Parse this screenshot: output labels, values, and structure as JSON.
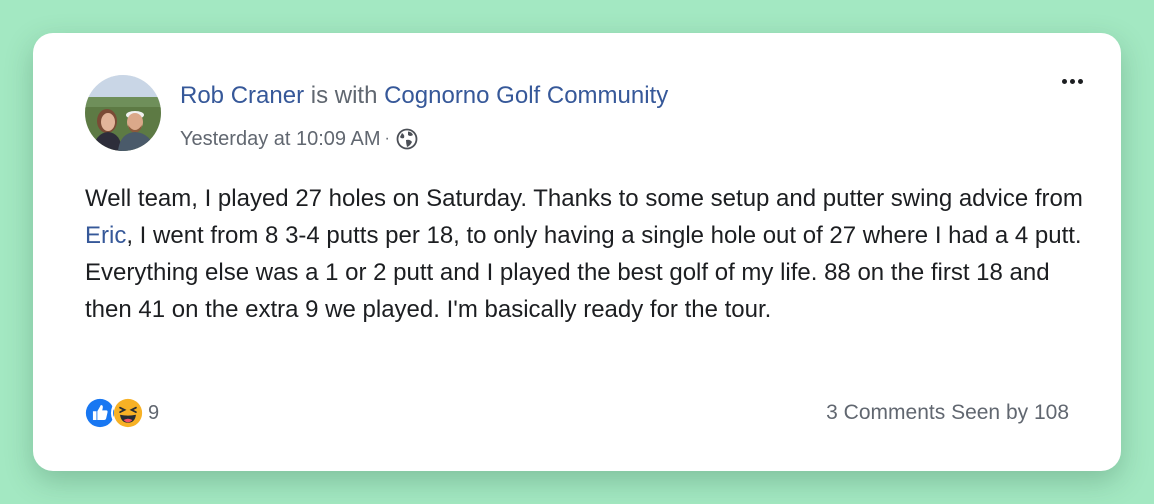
{
  "post": {
    "author": "Rob Craner",
    "with_text": "is with",
    "group": "Cognorno Golf Community",
    "timestamp": "Yesterday at 10:09 AM",
    "separator": "·",
    "privacy_icon": "globe-icon",
    "body_before_mention": "Well team, I played 27 holes on Saturday. Thanks to some setup and putter swing advice from ",
    "mention": "Eric",
    "body_after_mention": ", I went from 8 3-4 putts per 18, to only having a single hole out of 27 where I had a 4 putt. Everything else was a 1 or 2 putt and I played the best golf of my life. 88 on the first 18 and then 41 on the extra 9 we played. I'm basically ready for the tour."
  },
  "reactions": {
    "icons": [
      "like-icon",
      "haha-icon"
    ],
    "count": "9"
  },
  "footer": {
    "comments": "3 Comments",
    "seen": "Seen by 108"
  },
  "colors": {
    "background": "#a3e8c2",
    "link": "#365899",
    "text": "#1c1e21",
    "meta": "#616770"
  }
}
